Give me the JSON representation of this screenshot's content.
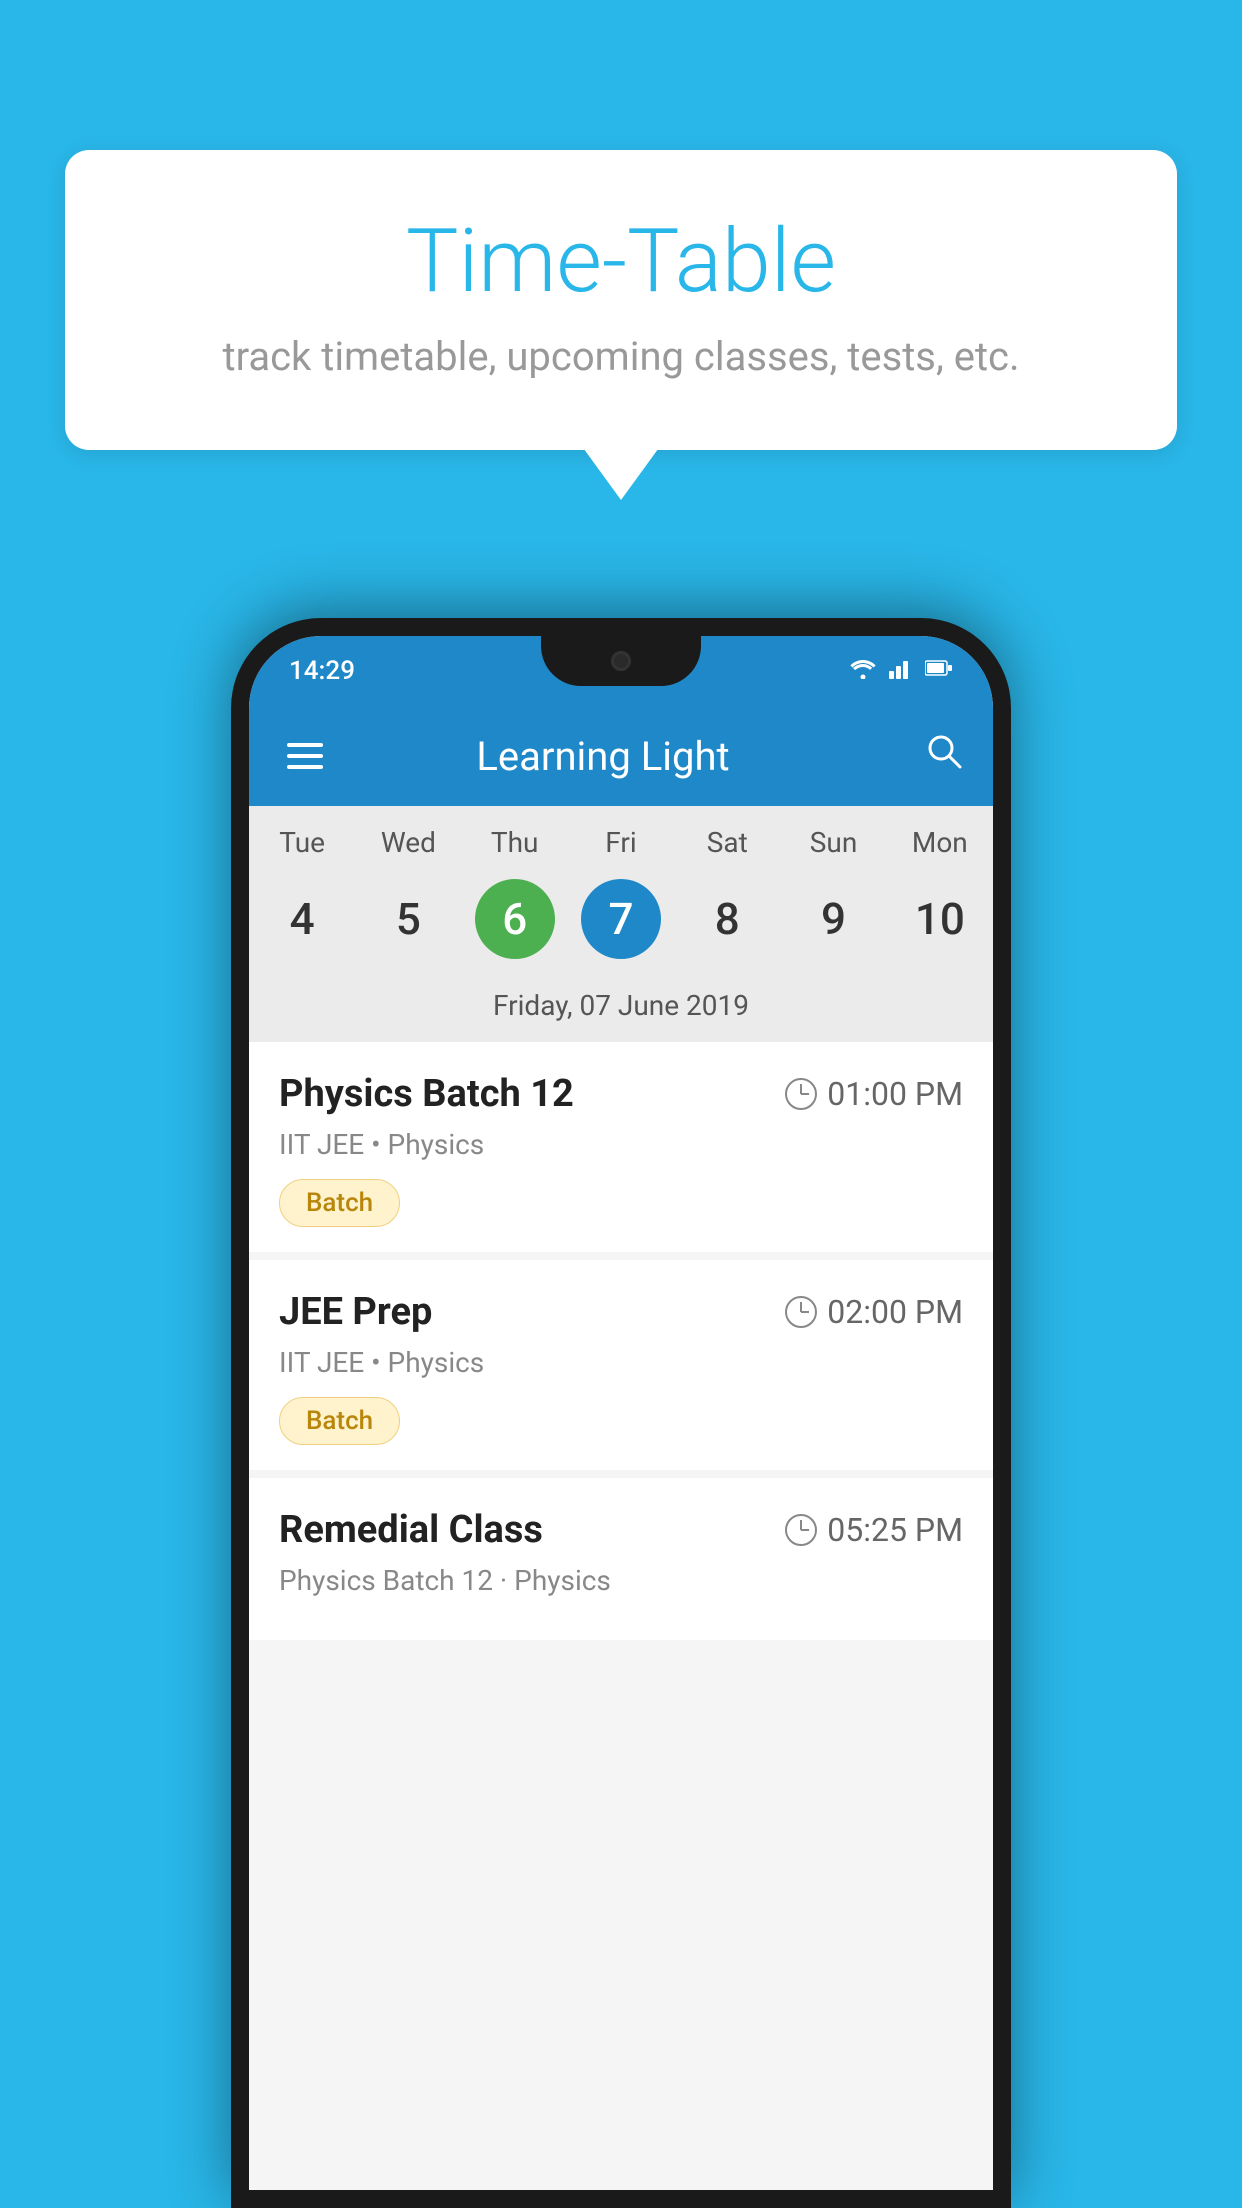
{
  "background_color": "#29b6e8",
  "bubble": {
    "title": "Time-Table",
    "subtitle": "track timetable, upcoming classes, tests, etc."
  },
  "status_bar": {
    "time": "14:29",
    "wifi": "wifi",
    "signal": "signal",
    "battery": "battery"
  },
  "toolbar": {
    "title": "Learning Light",
    "menu_icon": "menu",
    "search_icon": "search"
  },
  "calendar": {
    "days": [
      "Tue",
      "Wed",
      "Thu",
      "Fri",
      "Sat",
      "Sun",
      "Mon"
    ],
    "dates": [
      {
        "num": "4",
        "state": "normal"
      },
      {
        "num": "5",
        "state": "normal"
      },
      {
        "num": "6",
        "state": "today"
      },
      {
        "num": "7",
        "state": "selected"
      },
      {
        "num": "8",
        "state": "normal"
      },
      {
        "num": "9",
        "state": "normal"
      },
      {
        "num": "10",
        "state": "normal"
      }
    ],
    "selected_date_label": "Friday, 07 June 2019"
  },
  "schedule": [
    {
      "title": "Physics Batch 12",
      "time": "01:00 PM",
      "subtitle": "IIT JEE • Physics",
      "badge": "Batch"
    },
    {
      "title": "JEE Prep",
      "time": "02:00 PM",
      "subtitle": "IIT JEE • Physics",
      "badge": "Batch"
    },
    {
      "title": "Remedial Class",
      "time": "05:25 PM",
      "subtitle": "Physics Batch 12 · Physics",
      "badge": null
    }
  ]
}
